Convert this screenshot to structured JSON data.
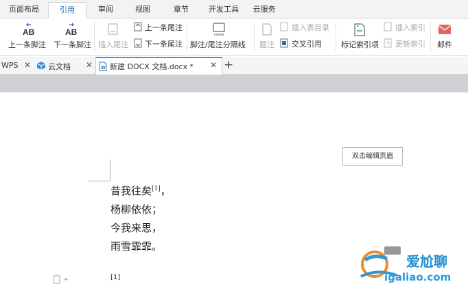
{
  "ribbon": {
    "tabs": [
      "页面布局",
      "引用",
      "审阅",
      "视图",
      "章节",
      "开发工具",
      "云服务"
    ],
    "active_tab": "引用",
    "buttons": {
      "prev_footnote": "上一条脚注",
      "next_footnote": "下一条脚注",
      "insert_endnote": "插入尾注",
      "prev_endnote": "上一条尾注",
      "next_endnote": "下一条尾注",
      "footnote_separator": "脚注/尾注分隔线",
      "caption": "题注",
      "insert_table_of_figures": "插入表目录",
      "cross_reference": "交叉引用",
      "mark_index_entry": "标记索引项",
      "insert_index": "插入索引",
      "update_index": "更新索引",
      "mail": "邮件"
    }
  },
  "doc_tabs": {
    "tabs": [
      "WPS",
      "云文档",
      "新建 DOCX 文档.docx *"
    ],
    "new_tab": "+"
  },
  "document": {
    "header_button": "双击编辑页眉",
    "poem": {
      "line1": "昔我往矣",
      "line1_ref": "[1]",
      "line1_end": "，",
      "line2": "杨柳依依；",
      "line3": "今我来思，",
      "line4": "雨雪霏霏。"
    },
    "footnote_marker": "[1]"
  },
  "watermark": {
    "brand": "爱尬聊",
    "domain": "igaliao.com"
  },
  "colors": {
    "accent": "#2b6cb8",
    "tab_indicator": "#4a90d9",
    "band": "#cfd0d3"
  }
}
